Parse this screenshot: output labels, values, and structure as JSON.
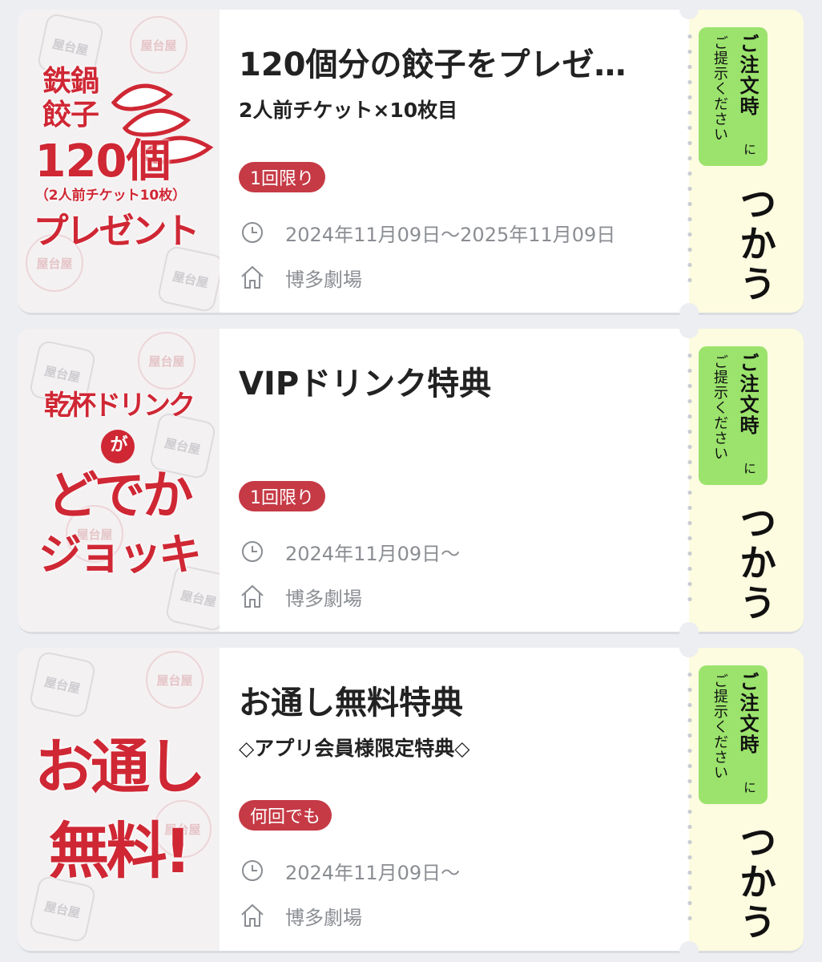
{
  "stub": {
    "pill_main": "ご注文時",
    "pill_ni": "に",
    "pill_sub": "ご提示ください",
    "use_label": "つかう"
  },
  "coupons": [
    {
      "banner_lines": [
        "鉄鍋",
        "餃子",
        "120個",
        "（2人前チケット10枚）",
        "プレゼント"
      ],
      "title": "120個分の餃子をプレゼ…",
      "subtitle": "2人前チケット×10枚目",
      "badge": "1回限り",
      "date": "2024年11月09日〜2025年11月09日",
      "venue": "博多劇場"
    },
    {
      "banner_lines": [
        "乾杯ドリンク",
        "が",
        "どでか",
        "ジョッキ"
      ],
      "title": "VIPドリンク特典",
      "subtitle": "",
      "badge": "1回限り",
      "date": "2024年11月09日〜",
      "venue": "博多劇場"
    },
    {
      "banner_lines": [
        "お通し",
        "無料!"
      ],
      "title": "お通し無料特典",
      "subtitle": "◇アプリ会員様限定特典◇",
      "badge": "何回でも",
      "date": "2024年11月09日〜",
      "venue": "博多劇場"
    }
  ],
  "watermark_text": "屋台屋",
  "icons": {
    "clock": "clock-icon",
    "venue": "home-icon"
  },
  "colors": {
    "badge": "#c53a45",
    "banner_text": "#cf2734",
    "pill": "#9be36c",
    "stub_bg": "#fdfbe0"
  }
}
